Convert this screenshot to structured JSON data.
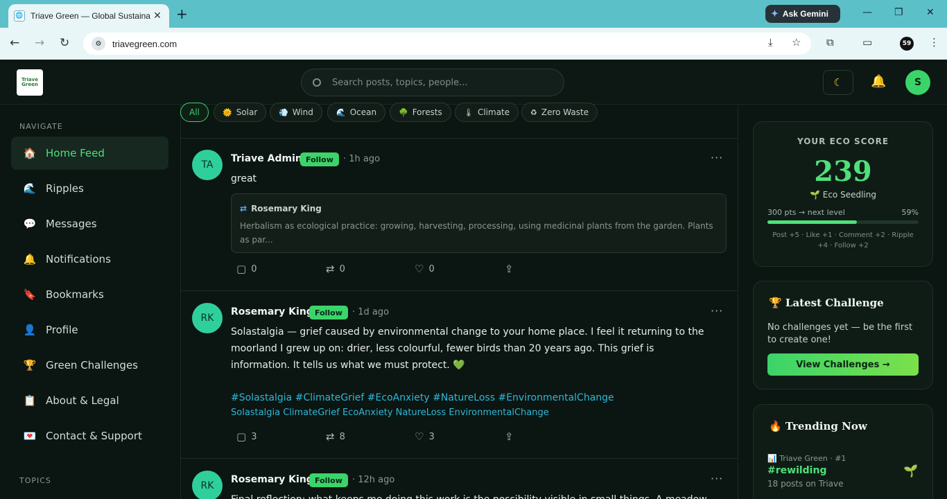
{
  "browser": {
    "tab_title": "Triave Green — Global Sustaina",
    "url": "triavegreen.com",
    "ask_gemini": "Ask Gemini",
    "profile_initials": "59"
  },
  "header": {
    "logo_text": "Triave Green",
    "search_placeholder": "Search posts, topics, people...",
    "avatar_initial": "S"
  },
  "sidebar": {
    "nav_label": "NAVIGATE",
    "items": [
      {
        "label": "Home Feed",
        "icon": "🏠"
      },
      {
        "label": "Ripples",
        "icon": "🌊"
      },
      {
        "label": "Messages",
        "icon": "💬"
      },
      {
        "label": "Notifications",
        "icon": "🔔"
      },
      {
        "label": "Bookmarks",
        "icon": "🔖"
      },
      {
        "label": "Profile",
        "icon": "👤"
      },
      {
        "label": "Green Challenges",
        "icon": "🏆"
      },
      {
        "label": "About & Legal",
        "icon": "📋"
      },
      {
        "label": "Contact & Support",
        "icon": "💌"
      }
    ],
    "topics_label": "TOPICS"
  },
  "filters": [
    {
      "label": "All",
      "icon": ""
    },
    {
      "label": "Solar",
      "icon": "🌞"
    },
    {
      "label": "Wind",
      "icon": "💨"
    },
    {
      "label": "Ocean",
      "icon": "🌊"
    },
    {
      "label": "Forests",
      "icon": "🌳"
    },
    {
      "label": "Climate",
      "icon": "🌡"
    },
    {
      "label": "Zero Waste",
      "icon": "♻"
    }
  ],
  "posts": [
    {
      "initials": "TA",
      "author": "Triave Admin",
      "follow": "Follow",
      "time": "· 1h ago",
      "text": "great",
      "quote_author": "Rosemary King",
      "quote_text": "Herbalism as ecological practice: growing, harvesting, processing, using medicinal plants from the garden. Plants as par...",
      "comments": "0",
      "reposts": "0",
      "likes": "0"
    },
    {
      "initials": "RK",
      "author": "Rosemary King",
      "follow": "Follow",
      "time": "· 1d ago",
      "text": "Solastalgia — grief caused by environmental change to your home place. I feel it returning to the moorland I grew up on: drier, less colourful, fewer birds than 20 years ago. This grief is information. It tells us what we must protect. 💚",
      "hashtags": "#Solastalgia #ClimateGrief #EcoAnxiety #NatureLoss #EnvironmentalChange",
      "tags_plain": "Solastalgia ClimateGrief EcoAnxiety NatureLoss EnvironmentalChange",
      "comments": "3",
      "reposts": "8",
      "likes": "3"
    },
    {
      "initials": "RK",
      "author": "Rosemary King",
      "follow": "Follow",
      "time": "· 12h ago",
      "text": "Final reflection: what keeps me doing this work is the possibility visible in small things. A meadow"
    }
  ],
  "eco": {
    "label": "YOUR ECO SCORE",
    "score": "239",
    "level": "🌱 Eco Seedling",
    "next": "300 pts → next level",
    "pct_text": "59%",
    "progress": 0.59,
    "rules": "Post +5 · Like +1 · Comment +2 · Ripple +4 · Follow +2"
  },
  "challenge": {
    "title": "🏆 Latest Challenge",
    "text": "No challenges yet — be the first to create one!",
    "button": "View Challenges →"
  },
  "trending": {
    "title": "🔥 Trending Now",
    "meta": "📊 Triave Green · #1",
    "tag": "#rewilding",
    "count": "18 posts on Triave"
  },
  "colors": {
    "accent": "#3bd46a",
    "link": "#2fb8d8",
    "bg": "#0b1511"
  }
}
